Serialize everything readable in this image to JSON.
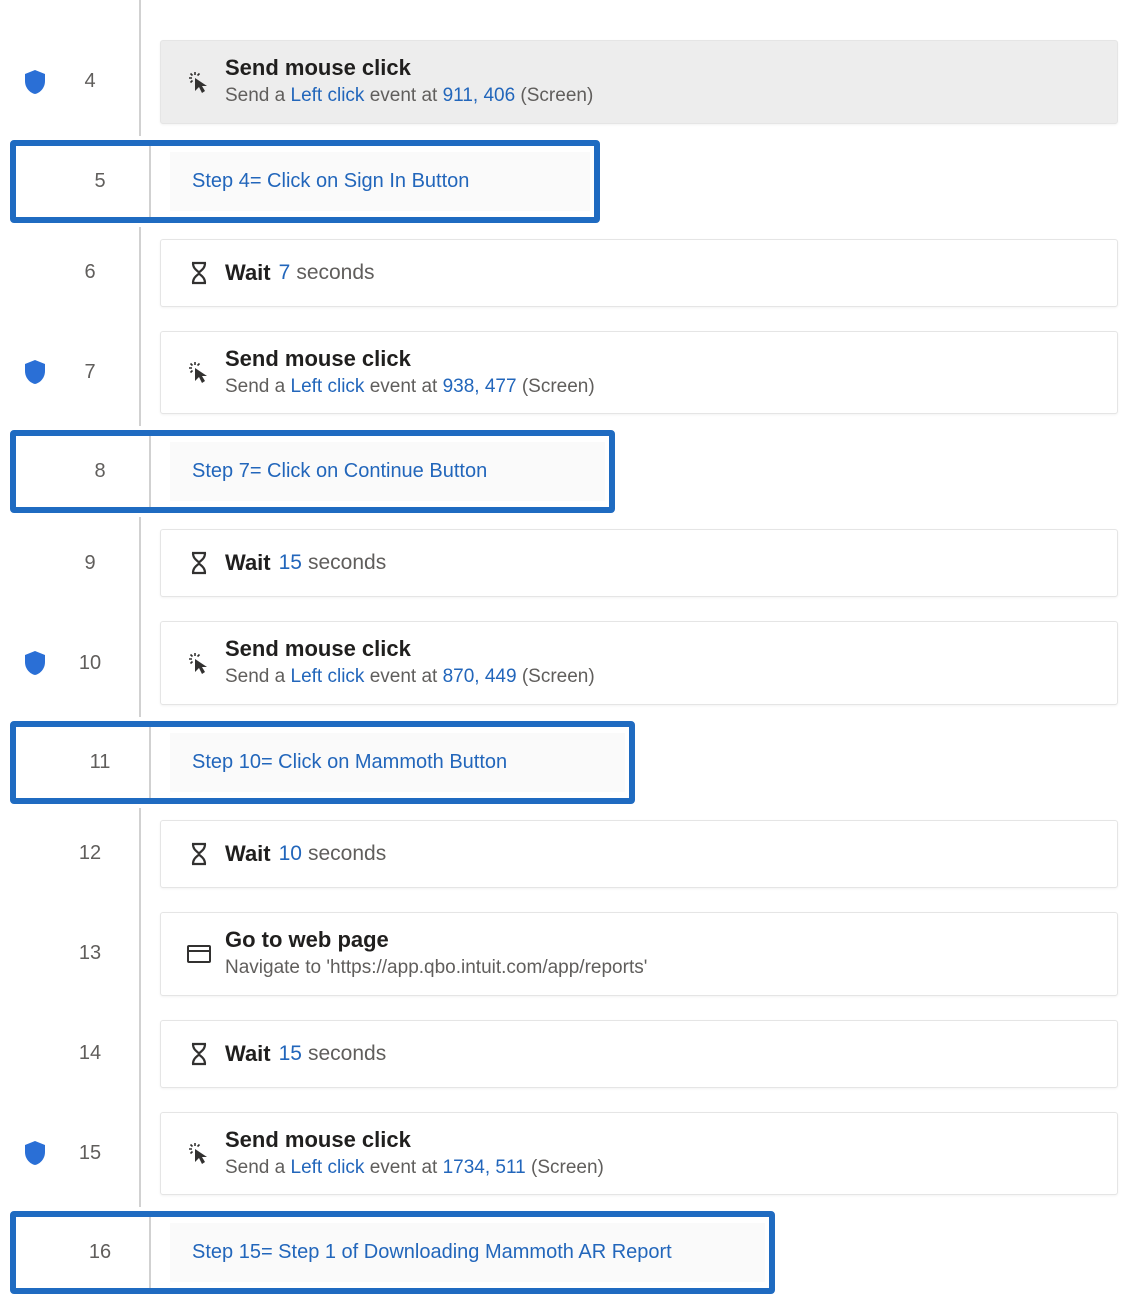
{
  "steps": {
    "s4": {
      "num": "4",
      "title": "Send mouse click",
      "desc_prefix": "Send a ",
      "click_type": "Left click",
      "desc_mid": " event at ",
      "coords": "911, 406",
      "desc_suffix": " (Screen)"
    },
    "s5": {
      "num": "5",
      "comment": "Step 4= Click on Sign In Button"
    },
    "s6": {
      "num": "6",
      "title": "Wait",
      "value": "7",
      "suffix": "seconds"
    },
    "s7": {
      "num": "7",
      "title": "Send mouse click",
      "desc_prefix": "Send a ",
      "click_type": "Left click",
      "desc_mid": " event at ",
      "coords": "938, 477",
      "desc_suffix": " (Screen)"
    },
    "s8": {
      "num": "8",
      "comment": "Step 7= Click on Continue Button"
    },
    "s9": {
      "num": "9",
      "title": "Wait",
      "value": "15",
      "suffix": "seconds"
    },
    "s10": {
      "num": "10",
      "title": "Send mouse click",
      "desc_prefix": "Send a ",
      "click_type": "Left click",
      "desc_mid": " event at ",
      "coords": "870, 449",
      "desc_suffix": " (Screen)"
    },
    "s11": {
      "num": "11",
      "comment": "Step 10= Click on Mammoth Button"
    },
    "s12": {
      "num": "12",
      "title": "Wait",
      "value": "10",
      "suffix": "seconds"
    },
    "s13": {
      "num": "13",
      "title": "Go to web page",
      "desc_prefix": "Navigate to '",
      "url": "https://app.qbo.intuit.com/app/reports",
      "desc_suffix": "'"
    },
    "s14": {
      "num": "14",
      "title": "Wait",
      "value": "15",
      "suffix": "seconds"
    },
    "s15": {
      "num": "15",
      "title": "Send mouse click",
      "desc_prefix": "Send a ",
      "click_type": "Left click",
      "desc_mid": " event at ",
      "coords": "1734, 511",
      "desc_suffix": " (Screen)"
    },
    "s16": {
      "num": "16",
      "comment": "Step 15= Step 1 of Downloading Mammoth AR Report"
    }
  }
}
